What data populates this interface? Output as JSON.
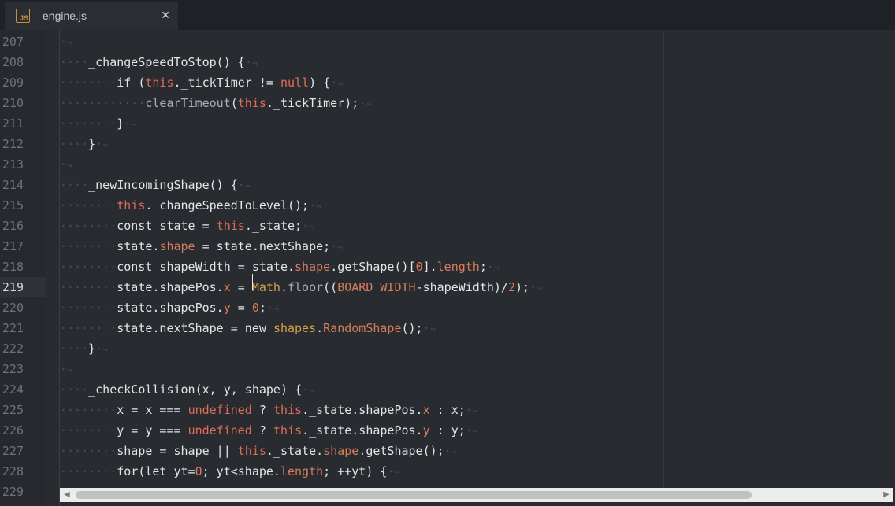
{
  "tab": {
    "icon_text": "JS",
    "filename": "engine.js",
    "close_glyph": "✕"
  },
  "editor": {
    "active_line": 219,
    "lines": [
      {
        "n": "207",
        "code": "·¬"
      },
      {
        "n": "208",
        "code": "····_changeSpeedToStop() {·¬"
      },
      {
        "n": "209",
        "code": "········if (this._tickTimer != null) {·¬"
      },
      {
        "n": "210",
        "code": "············clearTimeout(this._tickTimer);·¬"
      },
      {
        "n": "211",
        "code": "········}·¬"
      },
      {
        "n": "212",
        "code": "····}·¬"
      },
      {
        "n": "213",
        "code": "·¬"
      },
      {
        "n": "214",
        "code": "····_newIncomingShape() {·¬"
      },
      {
        "n": "215",
        "code": "········this._changeSpeedToLevel();·¬"
      },
      {
        "n": "216",
        "code": "········const state = this._state;·¬"
      },
      {
        "n": "217",
        "code": "········state.shape = state.nextShape;·¬"
      },
      {
        "n": "218",
        "code": "········const shapeWidth = state.shape.getShape()[0].length;·¬"
      },
      {
        "n": "219",
        "code": "········state.shapePos.x = Math.floor((BOARD_WIDTH-shapeWidth)/2);·¬"
      },
      {
        "n": "220",
        "code": "········state.shapePos.y = 0;·¬"
      },
      {
        "n": "221",
        "code": "········state.nextShape = new shapes.RandomShape();·¬"
      },
      {
        "n": "222",
        "code": "····}·¬"
      },
      {
        "n": "223",
        "code": "·¬"
      },
      {
        "n": "224",
        "code": "····_checkCollision(x, y, shape) {·¬"
      },
      {
        "n": "225",
        "code": "········x = x === undefined ? this._state.shapePos.x : x;·¬"
      },
      {
        "n": "226",
        "code": "········y = y === undefined ? this._state.shapePos.y : y;·¬"
      },
      {
        "n": "227",
        "code": "········shape = shape || this._state.shape.getShape();·¬"
      },
      {
        "n": "228",
        "code": "········for(let yt=0; yt<shape.length; ++yt) {·¬"
      },
      {
        "n": "229",
        "code": ""
      }
    ]
  },
  "scrollbar": {
    "left_arrow": "◀",
    "right_arrow": "▶",
    "position_fraction": 0.0
  },
  "colors": {
    "keyword": "#e06c57",
    "property": "#d77d5a",
    "class": "#d6a24a",
    "text": "#e3e4e6",
    "whitespace": "#4a4e55"
  }
}
